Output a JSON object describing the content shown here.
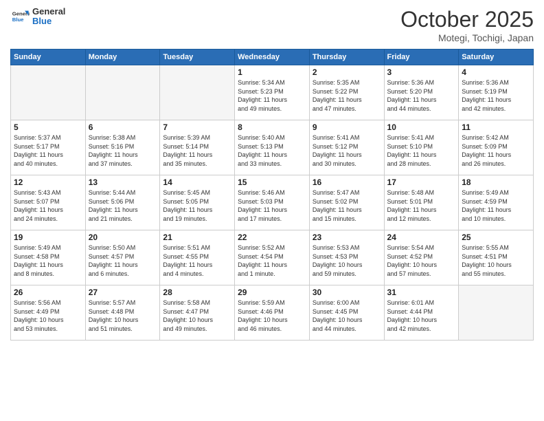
{
  "header": {
    "logo_general": "General",
    "logo_blue": "Blue",
    "month_title": "October 2025",
    "location": "Motegi, Tochigi, Japan"
  },
  "weekdays": [
    "Sunday",
    "Monday",
    "Tuesday",
    "Wednesday",
    "Thursday",
    "Friday",
    "Saturday"
  ],
  "weeks": [
    [
      {
        "day": "",
        "info": ""
      },
      {
        "day": "",
        "info": ""
      },
      {
        "day": "",
        "info": ""
      },
      {
        "day": "1",
        "info": "Sunrise: 5:34 AM\nSunset: 5:23 PM\nDaylight: 11 hours\nand 49 minutes."
      },
      {
        "day": "2",
        "info": "Sunrise: 5:35 AM\nSunset: 5:22 PM\nDaylight: 11 hours\nand 47 minutes."
      },
      {
        "day": "3",
        "info": "Sunrise: 5:36 AM\nSunset: 5:20 PM\nDaylight: 11 hours\nand 44 minutes."
      },
      {
        "day": "4",
        "info": "Sunrise: 5:36 AM\nSunset: 5:19 PM\nDaylight: 11 hours\nand 42 minutes."
      }
    ],
    [
      {
        "day": "5",
        "info": "Sunrise: 5:37 AM\nSunset: 5:17 PM\nDaylight: 11 hours\nand 40 minutes."
      },
      {
        "day": "6",
        "info": "Sunrise: 5:38 AM\nSunset: 5:16 PM\nDaylight: 11 hours\nand 37 minutes."
      },
      {
        "day": "7",
        "info": "Sunrise: 5:39 AM\nSunset: 5:14 PM\nDaylight: 11 hours\nand 35 minutes."
      },
      {
        "day": "8",
        "info": "Sunrise: 5:40 AM\nSunset: 5:13 PM\nDaylight: 11 hours\nand 33 minutes."
      },
      {
        "day": "9",
        "info": "Sunrise: 5:41 AM\nSunset: 5:12 PM\nDaylight: 11 hours\nand 30 minutes."
      },
      {
        "day": "10",
        "info": "Sunrise: 5:41 AM\nSunset: 5:10 PM\nDaylight: 11 hours\nand 28 minutes."
      },
      {
        "day": "11",
        "info": "Sunrise: 5:42 AM\nSunset: 5:09 PM\nDaylight: 11 hours\nand 26 minutes."
      }
    ],
    [
      {
        "day": "12",
        "info": "Sunrise: 5:43 AM\nSunset: 5:07 PM\nDaylight: 11 hours\nand 24 minutes."
      },
      {
        "day": "13",
        "info": "Sunrise: 5:44 AM\nSunset: 5:06 PM\nDaylight: 11 hours\nand 21 minutes."
      },
      {
        "day": "14",
        "info": "Sunrise: 5:45 AM\nSunset: 5:05 PM\nDaylight: 11 hours\nand 19 minutes."
      },
      {
        "day": "15",
        "info": "Sunrise: 5:46 AM\nSunset: 5:03 PM\nDaylight: 11 hours\nand 17 minutes."
      },
      {
        "day": "16",
        "info": "Sunrise: 5:47 AM\nSunset: 5:02 PM\nDaylight: 11 hours\nand 15 minutes."
      },
      {
        "day": "17",
        "info": "Sunrise: 5:48 AM\nSunset: 5:01 PM\nDaylight: 11 hours\nand 12 minutes."
      },
      {
        "day": "18",
        "info": "Sunrise: 5:49 AM\nSunset: 4:59 PM\nDaylight: 11 hours\nand 10 minutes."
      }
    ],
    [
      {
        "day": "19",
        "info": "Sunrise: 5:49 AM\nSunset: 4:58 PM\nDaylight: 11 hours\nand 8 minutes."
      },
      {
        "day": "20",
        "info": "Sunrise: 5:50 AM\nSunset: 4:57 PM\nDaylight: 11 hours\nand 6 minutes."
      },
      {
        "day": "21",
        "info": "Sunrise: 5:51 AM\nSunset: 4:55 PM\nDaylight: 11 hours\nand 4 minutes."
      },
      {
        "day": "22",
        "info": "Sunrise: 5:52 AM\nSunset: 4:54 PM\nDaylight: 11 hours\nand 1 minute."
      },
      {
        "day": "23",
        "info": "Sunrise: 5:53 AM\nSunset: 4:53 PM\nDaylight: 10 hours\nand 59 minutes."
      },
      {
        "day": "24",
        "info": "Sunrise: 5:54 AM\nSunset: 4:52 PM\nDaylight: 10 hours\nand 57 minutes."
      },
      {
        "day": "25",
        "info": "Sunrise: 5:55 AM\nSunset: 4:51 PM\nDaylight: 10 hours\nand 55 minutes."
      }
    ],
    [
      {
        "day": "26",
        "info": "Sunrise: 5:56 AM\nSunset: 4:49 PM\nDaylight: 10 hours\nand 53 minutes."
      },
      {
        "day": "27",
        "info": "Sunrise: 5:57 AM\nSunset: 4:48 PM\nDaylight: 10 hours\nand 51 minutes."
      },
      {
        "day": "28",
        "info": "Sunrise: 5:58 AM\nSunset: 4:47 PM\nDaylight: 10 hours\nand 49 minutes."
      },
      {
        "day": "29",
        "info": "Sunrise: 5:59 AM\nSunset: 4:46 PM\nDaylight: 10 hours\nand 46 minutes."
      },
      {
        "day": "30",
        "info": "Sunrise: 6:00 AM\nSunset: 4:45 PM\nDaylight: 10 hours\nand 44 minutes."
      },
      {
        "day": "31",
        "info": "Sunrise: 6:01 AM\nSunset: 4:44 PM\nDaylight: 10 hours\nand 42 minutes."
      },
      {
        "day": "",
        "info": ""
      }
    ]
  ]
}
